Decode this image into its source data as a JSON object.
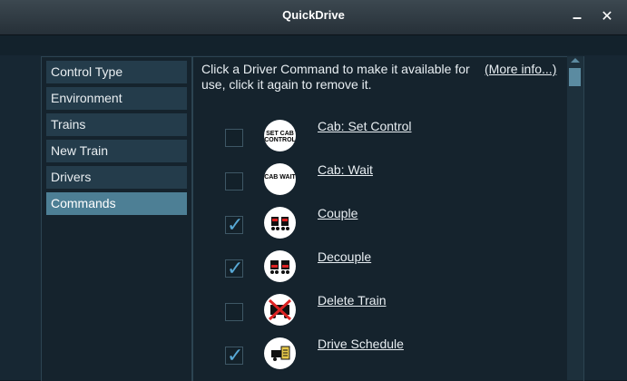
{
  "window": {
    "title": "QuickDrive",
    "minimize_label": "–",
    "close_label": "✕"
  },
  "sidebar": {
    "items": [
      {
        "label": "Control Type"
      },
      {
        "label": "Environment"
      },
      {
        "label": "Trains"
      },
      {
        "label": "New Train"
      },
      {
        "label": "Drivers"
      },
      {
        "label": "Commands"
      }
    ],
    "active": "Commands"
  },
  "panel": {
    "description": "Click a Driver Command to make it available for use, click it again to remove it.",
    "more_info": "(More info...)"
  },
  "commands": [
    {
      "label": "Cab: Set Control",
      "checked": false,
      "icon": "set-cab-control-icon",
      "icon_text": "SET CAB CONTROL"
    },
    {
      "label": "Cab: Wait",
      "checked": false,
      "icon": "cab-wait-icon",
      "icon_text": "CAB WAIT"
    },
    {
      "label": "Couple",
      "checked": true,
      "icon": "couple-icon",
      "icon_text": ""
    },
    {
      "label": "Decouple",
      "checked": true,
      "icon": "decouple-icon",
      "icon_text": ""
    },
    {
      "label": "Delete Train",
      "checked": false,
      "icon": "delete-train-icon",
      "icon_text": ""
    },
    {
      "label": "Drive Schedule",
      "checked": true,
      "icon": "drive-schedule-icon",
      "icon_text": ""
    }
  ],
  "colors": {
    "accent": "#4d7f95",
    "check": "#58a9d6"
  }
}
